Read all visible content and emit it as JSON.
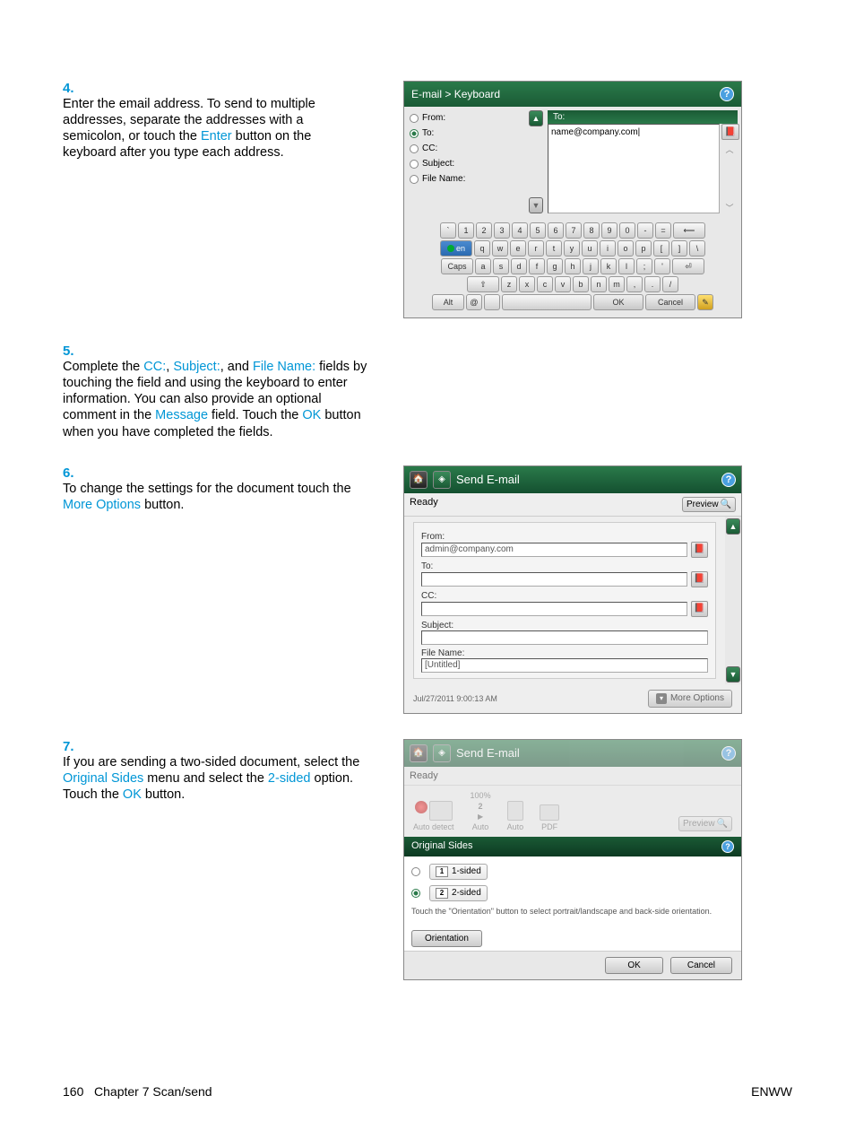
{
  "steps": {
    "s4": {
      "num": "4.",
      "text_a": "Enter the email address. To send to multiple addresses, separate the addresses with a semicolon, or touch the ",
      "link_a": "Enter",
      "text_b": " button on the keyboard after you type each address."
    },
    "s5": {
      "num": "5.",
      "text_a": "Complete the ",
      "link_a": "CC:",
      "sep_a": ", ",
      "link_b": "Subject:",
      "sep_b": ", and ",
      "link_c": "File Name:",
      "text_b": " fields by touching the field and using the keyboard to enter information. You can also provide an optional comment in the ",
      "link_d": "Message",
      "text_c": " field. Touch the ",
      "link_e": "OK",
      "text_d": " button when you have completed the fields."
    },
    "s6": {
      "num": "6.",
      "text_a": "To change the settings for the document touch the ",
      "link_a": "More Options",
      "text_b": " button."
    },
    "s7": {
      "num": "7.",
      "text_a": "If you are sending a two-sided document, select the ",
      "link_a": "Original Sides",
      "text_b": " menu and select the ",
      "link_b": "2-sided",
      "text_c": " option. Touch the ",
      "link_c": "OK",
      "text_d": " button."
    }
  },
  "screen1": {
    "breadcrumb_a": "E-mail",
    "breadcrumb_sep": " > ",
    "breadcrumb_b": "Keyboard",
    "fields": {
      "from": "From:",
      "to": "To:",
      "cc": "CC:",
      "subject": "Subject:",
      "filename": "File Name:"
    },
    "to_label": "To:",
    "to_value": "name@company.com|",
    "keys_r1": [
      "`",
      "1",
      "2",
      "3",
      "4",
      "5",
      "6",
      "7",
      "8",
      "9",
      "0",
      "-",
      "="
    ],
    "keys_r2_lang": "en",
    "keys_r2": [
      "q",
      "w",
      "e",
      "r",
      "t",
      "y",
      "u",
      "i",
      "o",
      "p",
      "[",
      "]",
      "\\"
    ],
    "keys_r3_caps": "Caps",
    "keys_r3": [
      "a",
      "s",
      "d",
      "f",
      "g",
      "h",
      "j",
      "k",
      "l",
      ";",
      "'"
    ],
    "keys_r4_shift": "⇧",
    "keys_r4": [
      "z",
      "x",
      "c",
      "v",
      "b",
      "n",
      "m",
      ",",
      ".",
      "/"
    ],
    "keys_r5_alt": "Alt",
    "keys_r5_at": "@",
    "ok": "OK",
    "cancel": "Cancel"
  },
  "screen2": {
    "title": "Send E-mail",
    "status": "Ready",
    "preview": "Preview",
    "from_lbl": "From:",
    "from_val": "admin@company.com",
    "to_lbl": "To:",
    "to_val": "",
    "cc_lbl": "CC:",
    "cc_val": "",
    "subject_lbl": "Subject:",
    "subject_val": "",
    "filename_lbl": "File Name:",
    "filename_val": "[Untitled]",
    "timestamp": "Jul/27/2011 9:00:13 AM",
    "more_options": "More Options"
  },
  "screen3": {
    "title": "Send E-mail",
    "status": "Ready",
    "tb_autodetect": "Auto detect",
    "tb_zoom": "100%",
    "tb_pages": "2",
    "tb_auto1": "Auto",
    "tb_auto2": "Auto",
    "tb_pdf": "PDF",
    "preview": "Preview",
    "section": "Original Sides",
    "opt1": "1-sided",
    "opt1_num": "1",
    "opt2": "2-sided",
    "opt2_num": "2",
    "hint": "Touch the \"Orientation\" button to select portrait/landscape and back-side orientation.",
    "orientation": "Orientation",
    "ok": "OK",
    "cancel": "Cancel"
  },
  "footer": {
    "page_num": "160",
    "chapter": "Chapter 7   Scan/send",
    "brand": "ENWW"
  }
}
